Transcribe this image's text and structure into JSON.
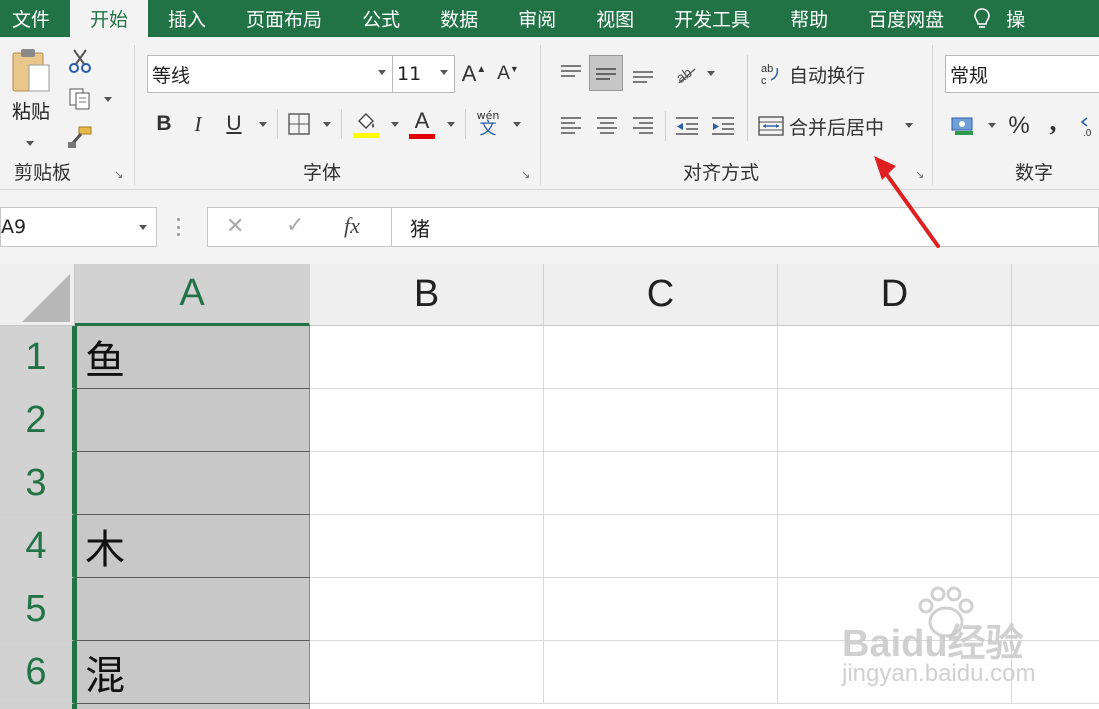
{
  "menu": {
    "tabs": [
      "文件",
      "开始",
      "插入",
      "页面布局",
      "公式",
      "数据",
      "审阅",
      "视图",
      "开发工具",
      "帮助",
      "百度网盘"
    ],
    "active_tab": "开始",
    "tell_me_partial": "操"
  },
  "ribbon": {
    "clipboard": {
      "paste_label": "粘贴",
      "group_label": "剪贴板"
    },
    "font": {
      "font_name": "等线",
      "font_size": "11",
      "group_label": "字体",
      "bold": "B",
      "italic": "I",
      "underline": "U",
      "grow": "A",
      "shrink": "A",
      "font_color_letter": "A",
      "phonetic_top": "wén",
      "phonetic_bottom": "文",
      "highlight_color": "#ffff00",
      "font_color": "#ff0000"
    },
    "alignment": {
      "wrap_text": "自动换行",
      "merge_center": "合并后居中",
      "group_label": "对齐方式"
    },
    "number": {
      "format": "常规",
      "percent": "%",
      "comma": ",",
      "group_label": "数字"
    }
  },
  "formula_bar": {
    "name_box": "A9",
    "cancel": "✕",
    "enter": "✓",
    "fx": "fx",
    "content": "猪"
  },
  "sheet": {
    "columns": [
      "A",
      "B",
      "C",
      "D"
    ],
    "rows": [
      "1",
      "2",
      "3",
      "4",
      "5",
      "6"
    ],
    "colA_values": [
      "鱼",
      "",
      "",
      "木",
      "",
      "混"
    ]
  },
  "watermark": {
    "brand": "Baidu经验",
    "url": "jingyan.baidu.com"
  },
  "colors": {
    "excel_green": "#217346",
    "annotation_arrow": "#e02020"
  }
}
